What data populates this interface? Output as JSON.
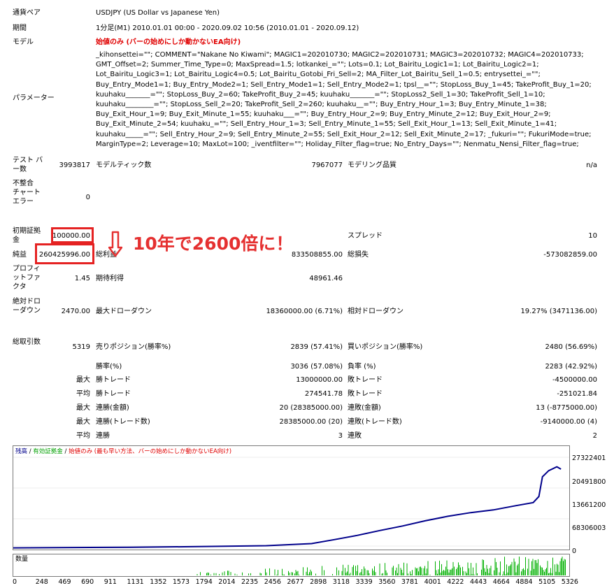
{
  "rows": {
    "symbol": {
      "label": "通貨ペア",
      "value": "USDJPY (US Dollar vs Japanese Yen)"
    },
    "period": {
      "label": "期間",
      "value": "1分足(M1) 2010.01.01 00:00 - 2020.09.02 10:56 (2010.01.01 - 2020.09.12)"
    },
    "model": {
      "label": "モデル",
      "value": "始値のみ (バーの始めにしか動かないEA向け)"
    },
    "params": {
      "label": "パラメーター",
      "value": "_kihonsettei=\"\"; COMMENT=\"Nakane No Kiwami\"; MAGIC1=202010730; MAGIC2=202010731; MAGIC3=202010732; MAGIC4=202010733; GMT_Offset=2; Summer_Time_Type=0; MaxSpread=1.5; lotkankei_=\"\"; Lots=0.1; Lot_Bairitu_Logic1=1; Lot_Bairitu_Logic2=1; Lot_Bairitu_Logic3=1; Lot_Bairitu_Logic4=0.5; Lot_Bairitu_Gotobi_Fri_Sell=2; MA_Filter_Lot_Bairitu_Sell_1=0.5; entrysettei_=\"\"; Buy_Entry_Mode1=1; Buy_Entry_Mode2=1; Sell_Entry_Mode1=1; Sell_Entry_Mode2=1; tpsl__=\"\"; StopLoss_Buy_1=45; TakeProfit_Buy_1=20; kuuhaku_______=\"\"; StopLoss_Buy_2=60; TakeProfit_Buy_2=45; kuuhaku_______=\"\"; StopLoss2_Sell_1=30; TakeProfit_Sell_1=10; kuuhaku________=\"\"; StopLoss_Sell_2=20; TakeProfit_Sell_2=260; kuuhaku__=\"\"; Buy_Entry_Hour_1=3; Buy_Entry_Minute_1=38; Buy_Exit_Hour_1=9; Buy_Exit_Minute_1=55; kuuhaku___=\"\"; Buy_Entry_Hour_2=9; Buy_Entry_Minute_2=12; Buy_Exit_Hour_2=9; Buy_Exit_Minute_2=54; kuuhaku_=\"\"; Sell_Entry_Hour_1=3; Sell_Entry_Minute_1=55; Sell_Exit_Hour_1=13; Sell_Exit_Minute_1=41; kuuhaku_____=\"\"; Sell_Entry_Hour_2=9; Sell_Entry_Minute_2=55; Sell_Exit_Hour_2=12; Sell_Exit_Minute_2=17; _fukuri=\"\"; FukuriMode=true; MarginType=2; Leverage=10; MaxLot=100; _iventfilter=\"\"; Holiday_Filter_flag=true; No_Entry_Days=\"\"; Nenmatu_Nensi_Filter_flag=true;"
    }
  },
  "stats": {
    "bars_label": "テスト バー数",
    "bars": "3993817",
    "ticks_label": "モデルティック数",
    "ticks": "7967077",
    "quality_label": "モデリング品質",
    "quality": "n/a",
    "mismatch_label": "不整合 チャート エラー",
    "mismatch": "0",
    "deposit_label": "初期証拠金",
    "deposit": "100000.00",
    "spread_label": "スプレッド",
    "spread": "10",
    "net_label": "純益",
    "net": "260425996.00",
    "gross_profit_label": "総利益",
    "gross_profit": "833508855.00",
    "gross_loss_label": "総損失",
    "gross_loss": "-573082859.00",
    "pf_label": "プロフィットファクタ",
    "pf": "1.45",
    "expected_label": "期待利得",
    "expected": "48961.46",
    "abs_dd_label": "絶対ドローダウン",
    "abs_dd": "2470.00",
    "max_dd_label": "最大ドローダウン",
    "max_dd": "18360000.00 (6.71%)",
    "rel_dd_label": "相対ドローダウン",
    "rel_dd": "19.27% (3471136.00)",
    "trades_label": "総取引数",
    "trades": "5319",
    "short_label": "売りポジション(勝率%)",
    "short": "2839 (57.41%)",
    "long_label": "買いポジション(勝率%)",
    "long": "2480 (56.69%)",
    "win_label": "勝率(%)",
    "win": "3036 (57.08%)",
    "loss_label": "負率 (%)",
    "loss": "2283 (42.92%)",
    "max_word": "最大",
    "avg_word": "平均",
    "max_win_trade_label": "勝トレード",
    "max_win_trade": "13000000.00",
    "max_loss_trade_label": "敗トレード",
    "max_loss_trade": "-4500000.00",
    "avg_win_trade_label": "勝トレード",
    "avg_win_trade": "274541.78",
    "avg_loss_trade_label": "敗トレード",
    "avg_loss_trade": "-251021.84",
    "cons_win_amt_label": "連勝(金額)",
    "cons_win_amt": "20 (28385000.00)",
    "cons_loss_amt_label": "連敗(金額)",
    "cons_loss_amt": "13 (-8775000.00)",
    "cons_win_cnt_label": "連勝(トレード数)",
    "cons_win_cnt": "28385000.00 (20)",
    "cons_loss_cnt_label": "連敗(トレード数)",
    "cons_loss_cnt": "-9140000.00 (4)",
    "avg_cons_win_label": "連勝",
    "avg_cons_win": "3",
    "avg_cons_loss_label": "連敗",
    "avg_cons_loss": "2"
  },
  "annotation": {
    "text": "10年で2600倍に！",
    "color": "#e53030"
  },
  "chart_legend": {
    "balance": "残高",
    "sep1": " / ",
    "equity": "有効証拠金",
    "sep2": " / ",
    "model": "始値のみ (最も早い方法、バーの始めにしか動かないEA向け)"
  },
  "volume_label": "数量",
  "colors": {
    "balance": "#00008b",
    "equity": "#00a000",
    "volume": "#00b000",
    "red": "#e00000"
  },
  "chart_data": {
    "type": "line",
    "y_ticks": [
      "27322401",
      "20491800",
      "13661200",
      "68306003",
      "0"
    ],
    "x_ticks": [
      "0",
      "248",
      "469",
      "690",
      "911",
      "1131",
      "1352",
      "1573",
      "1794",
      "2014",
      "2235",
      "2456",
      "2677",
      "2898",
      "3118",
      "3339",
      "3560",
      "3781",
      "4001",
      "4222",
      "4443",
      "4664",
      "4884",
      "5105",
      "5326"
    ],
    "ylim": [
      0,
      29000000
    ],
    "xlim": [
      0,
      5400
    ],
    "series": [
      {
        "name": "残高",
        "x": [
          0,
          1131,
          1794,
          2456,
          2898,
          3118,
          3339,
          3560,
          3781,
          4001,
          4222,
          4443,
          4664,
          4884,
          5050,
          5105,
          5140,
          5200,
          5280,
          5320
        ],
        "y": [
          100000,
          300000,
          500000,
          800000,
          1500000,
          2800000,
          4200000,
          5800000,
          7300000,
          9000000,
          10500000,
          11700000,
          12600000,
          14000000,
          15000000,
          17000000,
          23500000,
          25500000,
          26800000,
          26000000
        ]
      }
    ]
  }
}
